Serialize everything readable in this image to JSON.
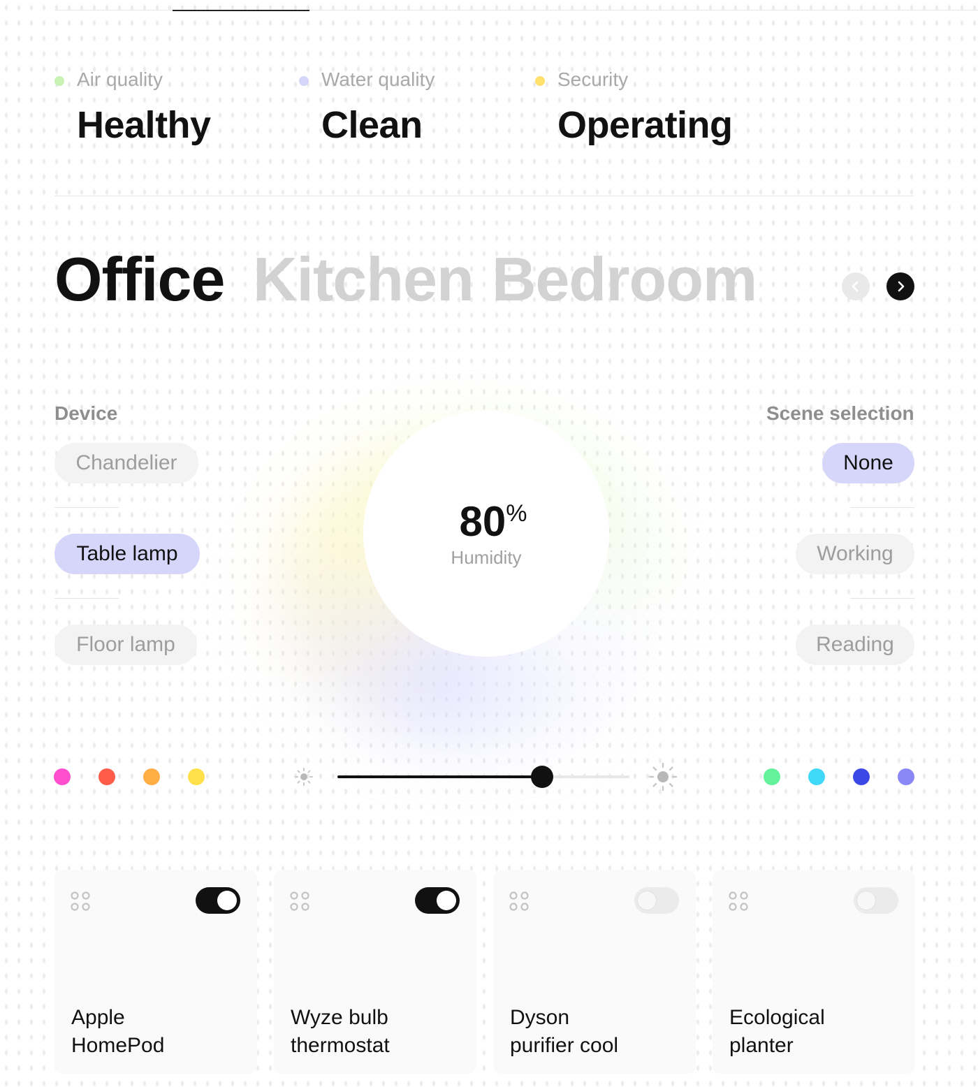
{
  "status": [
    {
      "label": "Air quality",
      "value": "Healthy",
      "color": "#c8f2b4"
    },
    {
      "label": "Water quality",
      "value": "Clean",
      "color": "#d6d6fa"
    },
    {
      "label": "Security",
      "value": "Operating",
      "color": "#ffe16b"
    }
  ],
  "rooms": {
    "tabs": [
      "Office",
      "Kitchen",
      "Bedroom"
    ],
    "active": "Office",
    "prev_icon": "chevron-left-icon",
    "next_icon": "chevron-right-icon"
  },
  "device": {
    "label": "Device",
    "items": [
      "Chandelier",
      "Table lamp",
      "Floor lamp"
    ],
    "selected": "Table lamp"
  },
  "scene": {
    "label": "Scene selection",
    "items": [
      "None",
      "Working",
      "Reading"
    ],
    "selected": "None"
  },
  "humidity": {
    "value": "80",
    "unit": "%",
    "label": "Humidity"
  },
  "brightness": {
    "level": 0.7,
    "min_icon": "sun-small-icon",
    "max_icon": "sun-large-icon"
  },
  "colors": {
    "warm": [
      "#ff4fce",
      "#ff5c4a",
      "#ffad45",
      "#ffe04a"
    ],
    "cool": [
      "#63f29a",
      "#3fd8f6",
      "#3b47e6",
      "#8a88f6"
    ]
  },
  "devices": [
    {
      "name_line1": "Apple",
      "name_line2": "HomePod",
      "on": true
    },
    {
      "name_line1": "Wyze bulb",
      "name_line2": "thermostat",
      "on": true
    },
    {
      "name_line1": "Dyson",
      "name_line2": "purifier cool",
      "on": false
    },
    {
      "name_line1": "Ecological",
      "name_line2": "planter",
      "on": false
    }
  ]
}
